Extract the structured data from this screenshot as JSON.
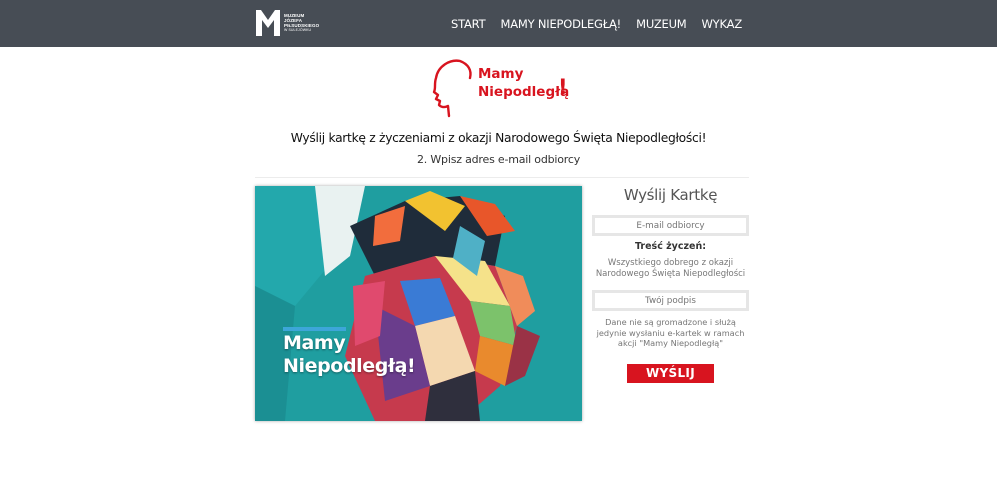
{
  "header": {
    "logo_lines": [
      "MUZEUM",
      "JÓZEFA",
      "PIŁSUDSKIEGO",
      "W SULEJÓWKU"
    ],
    "nav": [
      {
        "label": "START"
      },
      {
        "label": "MAMY NIEPODLEGŁĄ!"
      },
      {
        "label": "MUZEUM"
      },
      {
        "label": "WYKAZ"
      }
    ]
  },
  "hero": {
    "line1": "Mamy",
    "line2": "Niepodległą",
    "exclamation": "!"
  },
  "headline": "Wyślij kartkę z życzeniami z okazji Narodowego Święta Niepodległości!",
  "step": "2. Wpisz adres e-mail odbiorcy",
  "card": {
    "line1": "Mamy",
    "line2": "Niepodległą!"
  },
  "form": {
    "title": "Wyślij Kartkę",
    "email_placeholder": "E-mail odbiorcy",
    "wish_label": "Treść życzeń:",
    "wish_text": "Wszystkiego dobrego z okazji Narodowego Święta Niepodległości",
    "signature_placeholder": "Twój podpis",
    "disclaimer": "Dane nie są gromadzone i służą jedynie wysłaniu e-kartek w ramach akcji \"Mamy Niepodległą\"",
    "submit_label": "WYŚLIJ"
  },
  "colors": {
    "header_bg": "#474d55",
    "brand_red": "#d8141f",
    "card_teal": "#1f9ea0",
    "accent_blue": "#3da6d8"
  }
}
